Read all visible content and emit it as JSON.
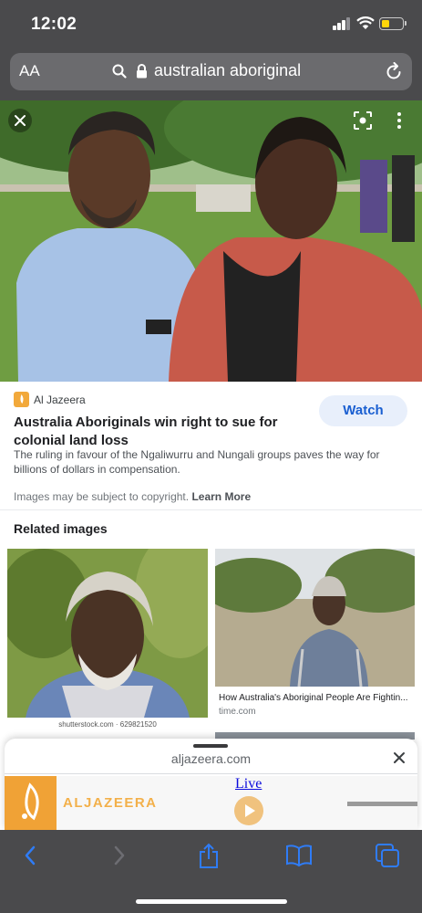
{
  "status_bar": {
    "time": "12:02"
  },
  "url_bar": {
    "text_size_label": "AA",
    "query": "australian aboriginal"
  },
  "result": {
    "source": "Al Jazeera",
    "watch_label": "Watch",
    "headline": "Australia Aboriginals win right to sue for colonial land loss",
    "summary": "The ruling in favour of the Ngaliwurru and Nungali groups paves the way for billions of dollars in compensation.",
    "copyright_text": "Images may be subject to copyright.",
    "learn_more": "Learn More"
  },
  "related": {
    "title": "Related images",
    "items": [
      {
        "caption": "shutterstock.com · 629821520"
      },
      {
        "title": "How Australia's Aboriginal People Are Fightin...",
        "source": "time.com"
      }
    ]
  },
  "sheet": {
    "domain": "aljazeera.com",
    "brand": "ALJAZEERA",
    "live_label": "Live"
  },
  "colors": {
    "chrome": "#4a4a4c",
    "accent_blue": "#1a5fd1",
    "toolbar_icon": "#2f7cf6",
    "aj_orange": "#f0a236"
  },
  "icons": {
    "back": "chevron-left-icon",
    "forward": "chevron-right-icon",
    "share": "share-icon",
    "bookmarks": "book-icon",
    "tabs": "tabs-icon"
  }
}
